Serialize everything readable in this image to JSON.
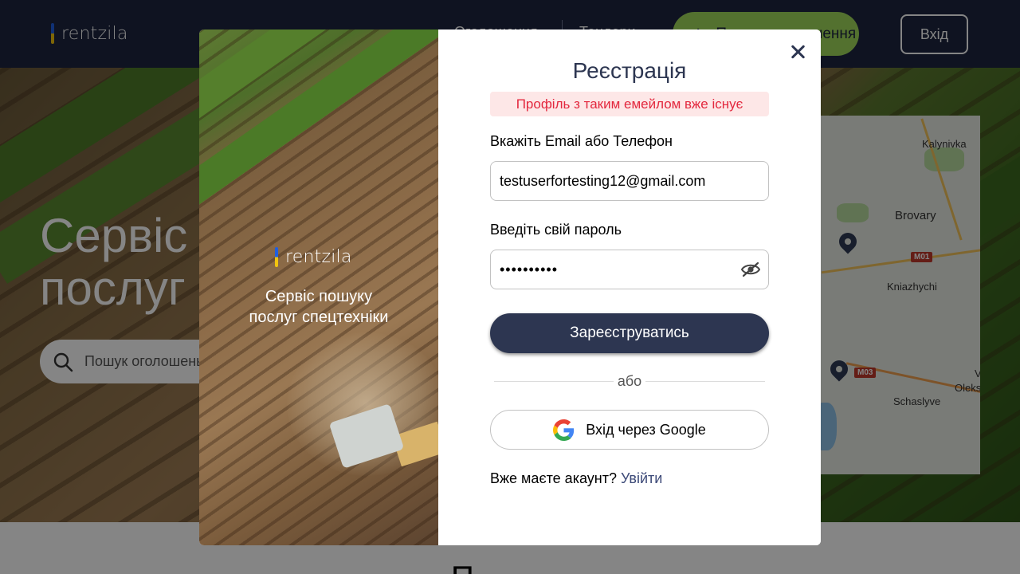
{
  "header": {
    "logo_text": "rentzila",
    "nav_item_1": "Оголошення",
    "nav_item_2": "Тендери",
    "add_button_label": "Подати оголошення",
    "login_button_label": "Вхід"
  },
  "hero": {
    "title_line_1": "Сервіс пошуку",
    "title_line_2": "послуг спецтехніки",
    "search_placeholder": "Пошук оголошень або послуг"
  },
  "map": {
    "labels": [
      "Kalynivka",
      "Brovary",
      "Kniazhychi",
      "Schaslyve",
      "Oleks",
      "V"
    ],
    "road_badges": [
      "M01",
      "M03"
    ]
  },
  "below": {
    "heading": "П"
  },
  "modal": {
    "left": {
      "logo_text": "rentzila",
      "tagline_line_1": "Сервіс пошуку",
      "tagline_line_2": "послуг спецтехніки"
    },
    "title": "Реєстрація",
    "error_message": "Профіль з таким емейлом вже існує",
    "email_label": "Вкажіть Email або Телефон",
    "email_value": "testuserfortesting12@gmail.com",
    "password_label": "Введіть свій пароль",
    "password_value": "••••••••••",
    "submit_label": "Зареєструватись",
    "divider_text": "або",
    "google_label": "Вхід через Google",
    "have_account_text": "Вже маєте акаунт?",
    "login_link": "Увійти"
  },
  "colors": {
    "brand_dark": "#2d3651",
    "accent_green": "#9fd85b",
    "error_text": "#e3283e",
    "error_bg": "#fde7e7"
  }
}
